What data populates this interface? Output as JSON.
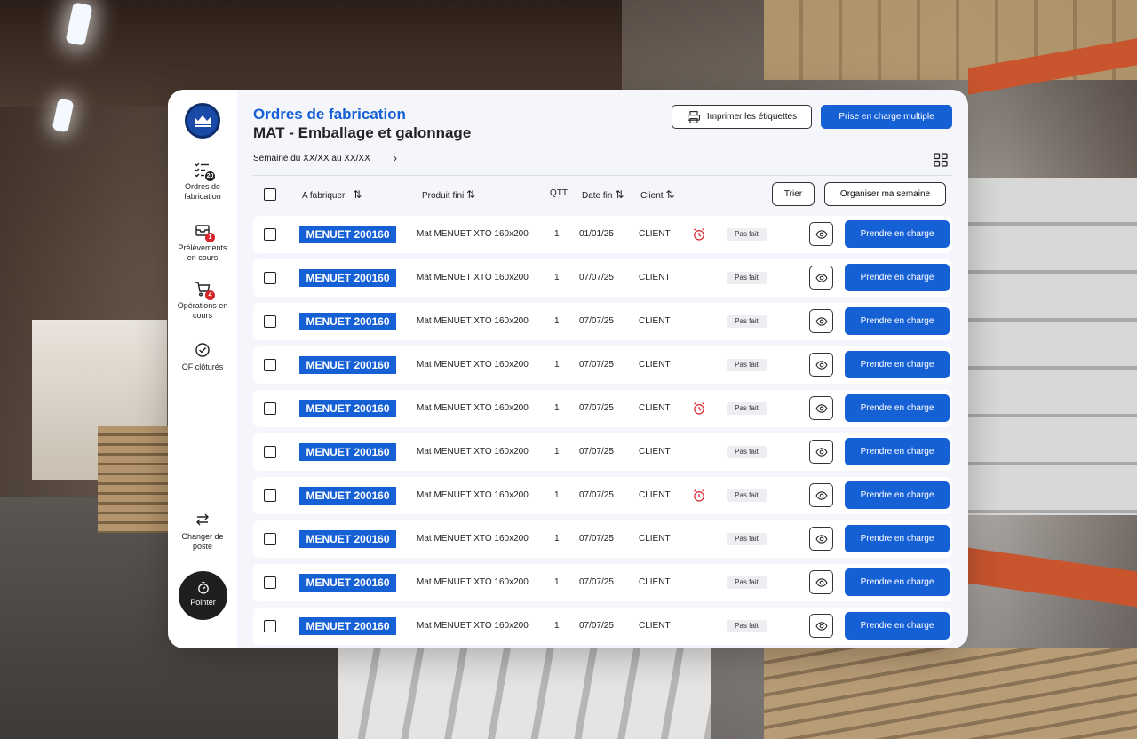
{
  "sidebar": {
    "items": [
      {
        "label": "Ordres de\nfabrication",
        "icon": "list-check-icon",
        "badge": "20"
      },
      {
        "label": "Prélèvements\nen cours",
        "icon": "inbox-icon",
        "badge": "1"
      },
      {
        "label": "Opérations en\ncours",
        "icon": "cart-icon",
        "badge": "4"
      },
      {
        "label": "OF clôturés",
        "icon": "check-circle-icon",
        "badge": ""
      }
    ],
    "switch_label": "Changer de\nposte",
    "pointer_label": "Pointer"
  },
  "header": {
    "title": "Ordres de fabrication",
    "subtitle": "MAT - Emballage et galonnage",
    "print_label": "Imprimer les étiquettes",
    "multi_label": "Prise en charge multiple",
    "week": "Semaine du XX/XX au XX/XX"
  },
  "table": {
    "headers": {
      "to_make": "A fabriquer",
      "finished_product": "Produit fini",
      "qty": "QTT",
      "end_date": "Date fin",
      "client": "Client"
    },
    "sort_label": "Trier",
    "organize_label": "Organiser ma semaine",
    "take_label": "Prendre en charge",
    "rows": [
      {
        "ref": "MENUET 200160",
        "product": "Mat MENUET XTO 160x200",
        "qty": "1",
        "date": "01/01/25",
        "client": "CLIENT",
        "alarm": true,
        "status": "Pas fait"
      },
      {
        "ref": "MENUET 200160",
        "product": "Mat MENUET XTO 160x200",
        "qty": "1",
        "date": "07/07/25",
        "client": "CLIENT",
        "alarm": false,
        "status": "Pas fait"
      },
      {
        "ref": "MENUET 200160",
        "product": "Mat MENUET XTO 160x200",
        "qty": "1",
        "date": "07/07/25",
        "client": "CLIENT",
        "alarm": false,
        "status": "Pas fait"
      },
      {
        "ref": "MENUET 200160",
        "product": "Mat MENUET XTO 160x200",
        "qty": "1",
        "date": "07/07/25",
        "client": "CLIENT",
        "alarm": false,
        "status": "Pas fait"
      },
      {
        "ref": "MENUET 200160",
        "product": "Mat MENUET XTO 160x200",
        "qty": "1",
        "date": "07/07/25",
        "client": "CLIENT",
        "alarm": true,
        "status": "Pas fait"
      },
      {
        "ref": "MENUET 200160",
        "product": "Mat MENUET XTO 160x200",
        "qty": "1",
        "date": "07/07/25",
        "client": "CLIENT",
        "alarm": false,
        "status": "Pas fait"
      },
      {
        "ref": "MENUET 200160",
        "product": "Mat MENUET XTO 160x200",
        "qty": "1",
        "date": "07/07/25",
        "client": "CLIENT",
        "alarm": true,
        "status": "Pas fait"
      },
      {
        "ref": "MENUET 200160",
        "product": "Mat MENUET XTO 160x200",
        "qty": "1",
        "date": "07/07/25",
        "client": "CLIENT",
        "alarm": false,
        "status": "Pas fait"
      },
      {
        "ref": "MENUET 200160",
        "product": "Mat MENUET XTO 160x200",
        "qty": "1",
        "date": "07/07/25",
        "client": "CLIENT",
        "alarm": false,
        "status": "Pas fait"
      },
      {
        "ref": "MENUET 200160",
        "product": "Mat MENUET XTO 160x200",
        "qty": "1",
        "date": "07/07/25",
        "client": "CLIENT",
        "alarm": false,
        "status": "Pas fait"
      }
    ]
  },
  "colors": {
    "accent": "#1660d6",
    "alarm": "#d7262b",
    "dark_button": "#1f1f1f"
  }
}
